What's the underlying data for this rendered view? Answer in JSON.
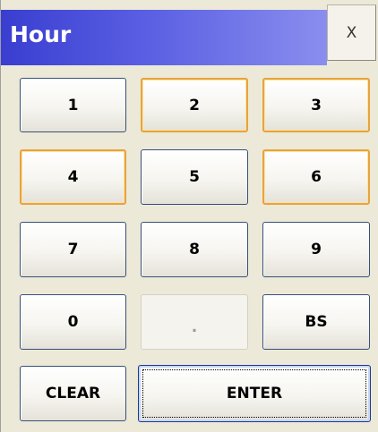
{
  "dialog": {
    "title": "Hour",
    "close_label": "X"
  },
  "keypad": {
    "k1": "1",
    "k2": "2",
    "k3": "3",
    "k4": "4",
    "k5": "5",
    "k6": "6",
    "k7": "7",
    "k8": "8",
    "k9": "9",
    "k0": "0",
    "dot": ".",
    "bs": "BS",
    "clear": "CLEAR",
    "enter": "ENTER"
  },
  "colors": {
    "title_gradient_start": "#3a3ed0",
    "title_gradient_end": "#8a8eee",
    "hover_border": "#e8a33c",
    "button_border": "#36507a",
    "dialog_background": "#ece9d8"
  }
}
